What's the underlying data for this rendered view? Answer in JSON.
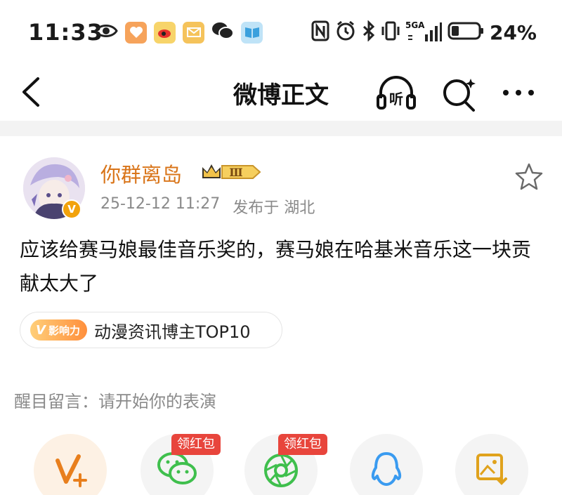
{
  "status_bar": {
    "time": "11:33",
    "network": "5GA",
    "battery": "24%",
    "left_icons": [
      "eye-icon",
      "heart-app-icon",
      "weibo-icon",
      "mail-icon",
      "wechat-icon",
      "book-icon"
    ],
    "right_icons": [
      "nfc-icon",
      "alarm-icon",
      "bluetooth-icon",
      "vibrate-icon",
      "signal-icon",
      "battery-icon"
    ]
  },
  "nav": {
    "title": "微博正文",
    "listen_label": "听"
  },
  "post": {
    "username": "你群离岛",
    "vip_level": "Ⅲ",
    "avatar_badge": "V",
    "timestamp": "25-12-12 11:27",
    "location": "发布于 湖北",
    "content": "应该给赛马娘最佳音乐奖的，赛马娘在哈基米音乐这一块贡献太大了",
    "influence": {
      "tag_mark": "V",
      "tag_label": "影响力",
      "text": "动漫资讯博主TOP10"
    },
    "comment_hint": "醒目留言：请开始你的表演"
  },
  "share": {
    "redpacket_label": "领红包",
    "items": [
      {
        "name": "vplus-icon",
        "redpacket": false
      },
      {
        "name": "wechat-icon",
        "redpacket": true
      },
      {
        "name": "moments-icon",
        "redpacket": true
      },
      {
        "name": "qq-icon",
        "redpacket": false
      },
      {
        "name": "save-image-icon",
        "redpacket": false
      }
    ]
  },
  "colors": {
    "accent_orange": "#d9751a",
    "redpacket": "#e8453c",
    "wechat_green": "#3fbf4d",
    "qq_blue": "#3a9bf0"
  }
}
